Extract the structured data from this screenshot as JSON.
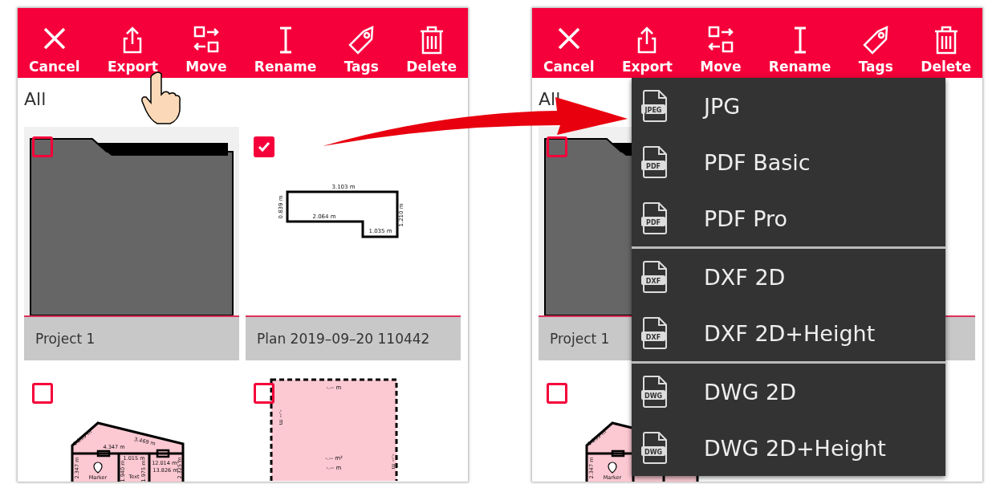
{
  "screens": [
    {
      "toolbar": [
        {
          "label": "Cancel"
        },
        {
          "label": "Export"
        },
        {
          "label": "Move"
        },
        {
          "label": "Rename"
        },
        {
          "label": "Tags"
        },
        {
          "label": "Delete"
        }
      ],
      "section": "All",
      "pointer": true,
      "cards": [
        {
          "kind": "folder",
          "label": "Project 1",
          "checked": false
        },
        {
          "kind": "plan",
          "label": "Plan 2019–09–20 110442",
          "checked": true,
          "dims": [
            "3.103 m",
            "0.839 m",
            "2.064 m",
            "1.210 m",
            "1.035 m"
          ]
        },
        {
          "kind": "house",
          "checked": false,
          "dims": [
            "1.295 m",
            "3.469 m",
            "4.347 m",
            "12.014 m²",
            "13.826 m",
            "2.347 m",
            "2.325 m",
            "Marker",
            "Text",
            "1.015 m",
            "1.940 m",
            "1.975 m"
          ]
        },
        {
          "kind": "empty-plan",
          "checked": false,
          "dims": [
            "-.-- m",
            "-.-- m",
            "-.-- m²",
            "-.-- m",
            "-.-- m"
          ]
        }
      ]
    },
    {
      "toolbar": [
        {
          "label": "Cancel"
        },
        {
          "label": "Export"
        },
        {
          "label": "Move"
        },
        {
          "label": "Rename"
        },
        {
          "label": "Tags"
        },
        {
          "label": "Delete"
        }
      ],
      "section": "All",
      "pointer": false,
      "cards": [
        {
          "kind": "folder",
          "label": "Project 1",
          "checked": false
        },
        {
          "kind": "covered"
        },
        {
          "kind": "house-left",
          "checked": false,
          "dims": [
            "1.295 m",
            "2.347 m",
            "Marker"
          ]
        },
        {
          "kind": "covered"
        }
      ],
      "menu": [
        [
          {
            "label": "JPG",
            "badge": "JPEG"
          },
          {
            "label": "PDF Basic",
            "badge": "PDF"
          },
          {
            "label": "PDF Pro",
            "badge": "PDF"
          }
        ],
        [
          {
            "label": "DXF 2D",
            "badge": "DXF"
          },
          {
            "label": "DXF 2D+Height",
            "badge": "DXF"
          }
        ],
        [
          {
            "label": "DWG 2D",
            "badge": "DWG"
          },
          {
            "label": "DWG 2D+Height",
            "badge": "DWG"
          }
        ]
      ]
    }
  ]
}
